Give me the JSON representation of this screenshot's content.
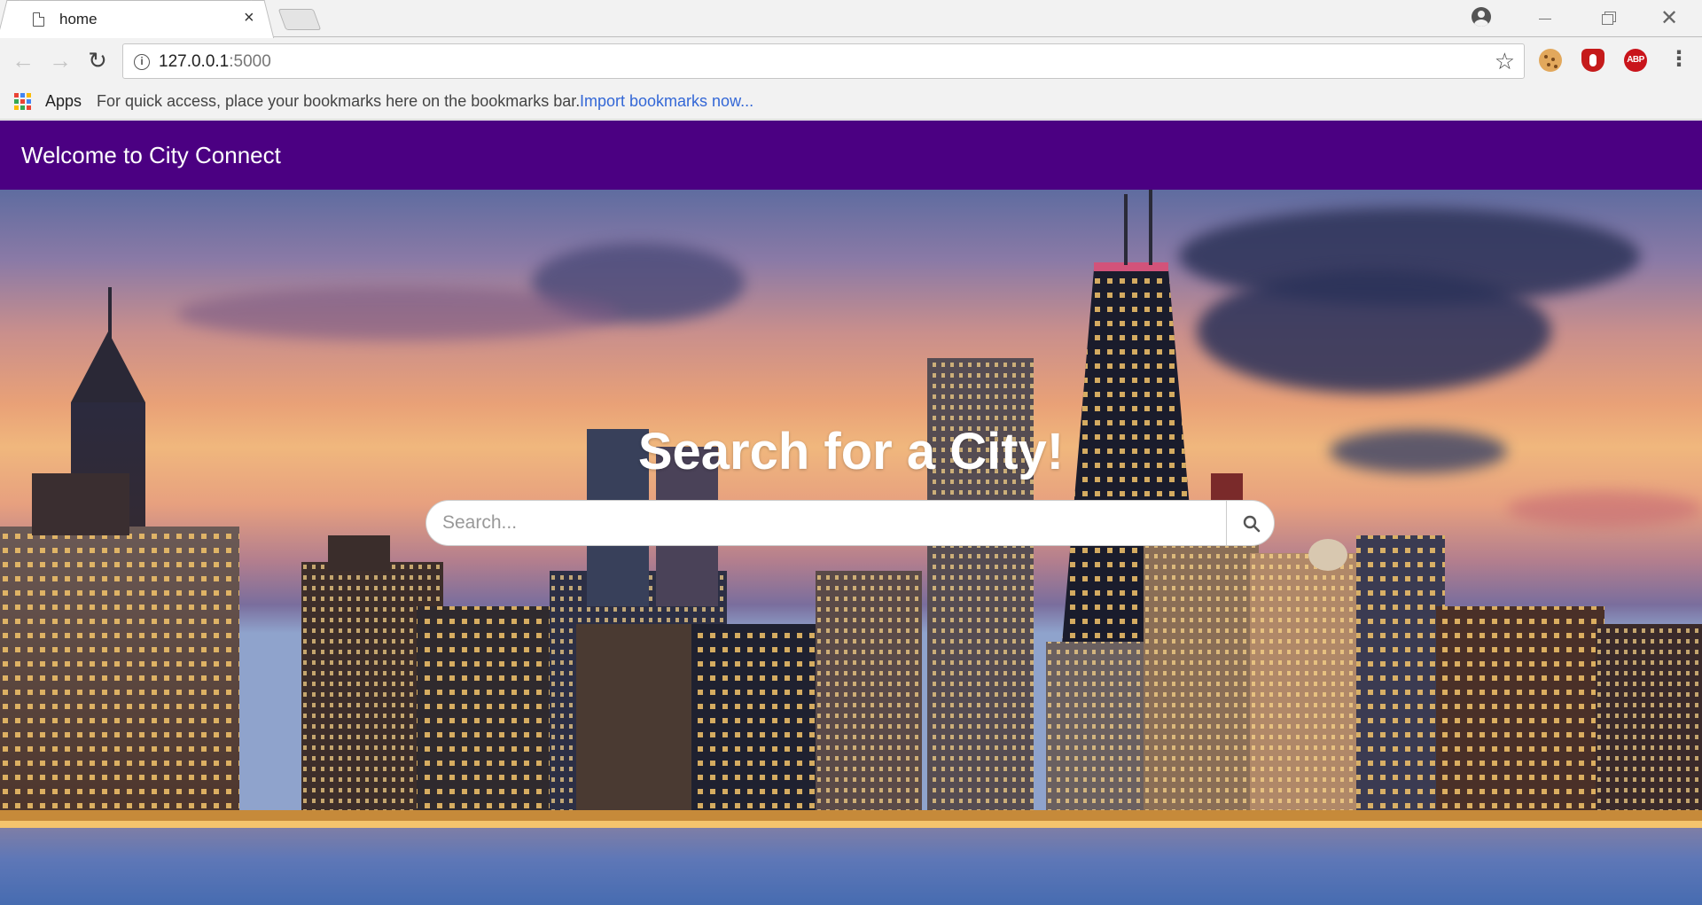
{
  "browser": {
    "tab_title": "home",
    "tab_close": "×",
    "url_host": "127.0.0.1",
    "url_port": ":5000",
    "apps_label": "Apps",
    "bookmarks_hint": "For quick access, place your bookmarks here on the bookmarks bar.",
    "import_bookmarks": "Import bookmarks now...",
    "extensions": [
      "cookie-icon",
      "ublock-icon",
      "adblock-plus-icon"
    ],
    "abp_text": "ABP"
  },
  "page": {
    "brand": "Welcome to City Connect",
    "navbar_color": "#4b0082",
    "hero_title": "Search for a City!",
    "search": {
      "placeholder": "Search...",
      "value": ""
    }
  }
}
